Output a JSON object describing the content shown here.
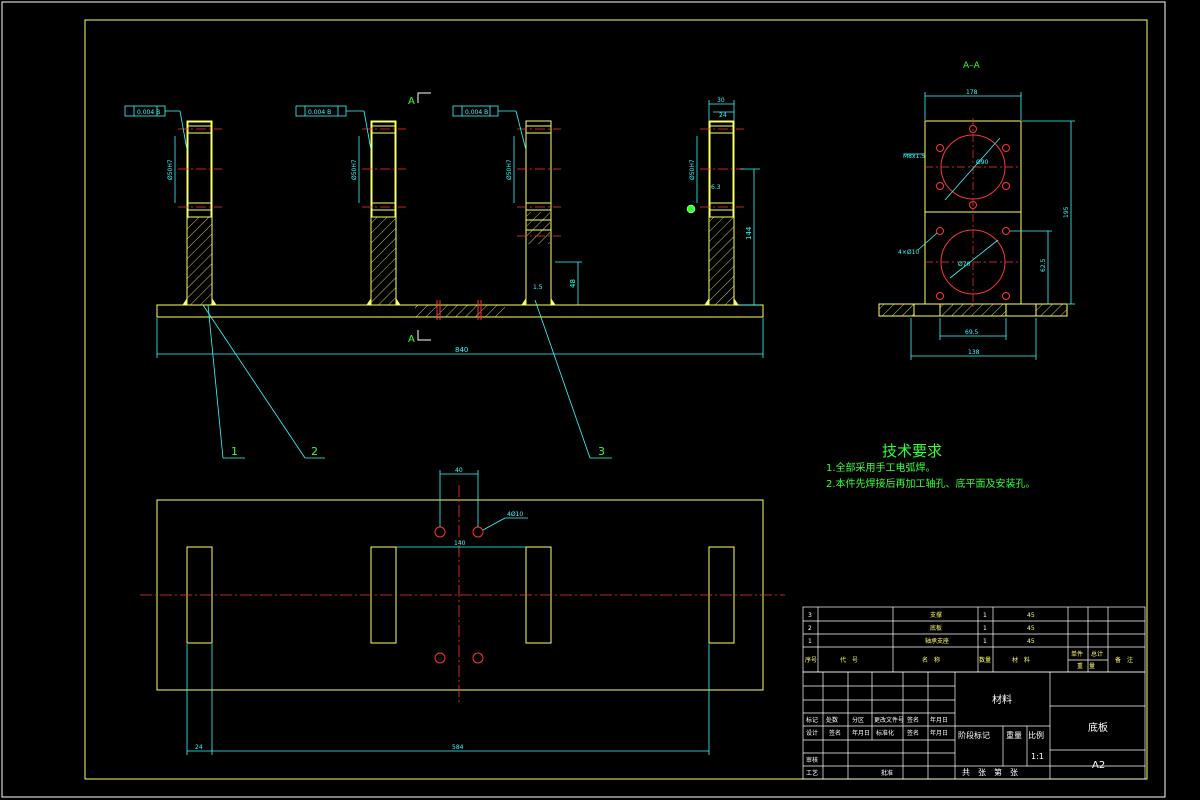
{
  "view_labels": {
    "section_A_top": "A",
    "section_A_bottom": "A",
    "section_view_title": "A–A"
  },
  "tolerances": [
    "0.004 B",
    "0.004 B",
    "0.004 B"
  ],
  "dimensions": {
    "overall_length": "840",
    "tube_height": "144",
    "weld_height": "48",
    "side_width": "178",
    "side_height": "195",
    "side_base_width": "138",
    "side_base_inner": "69.5",
    "side_hole_height": "62.5",
    "circle_top": "Ø90",
    "circle_bottom": "Ø70",
    "hole_spec_top": "M8x1.5",
    "hole_spec_left": "4×Ø10",
    "plan_hole_spacing": "40",
    "plan_center_span": "140",
    "plan_edge": "24",
    "plan_span": "584",
    "plan_hole_spec": "4Ø10",
    "bolt_dim": "30",
    "bolt_sub": "24",
    "chamfer": "1.5",
    "fit_1": "Ø50H7",
    "fit_2": "Ø50H7",
    "fit_3": "Ø50H7",
    "fit_4": "Ø50H7",
    "spot": "6.3"
  },
  "balloons": [
    "1",
    "2",
    "3"
  ],
  "tech_requirements": {
    "title": "技术要求",
    "items": [
      "1.全部采用手工电弧焊。",
      "2.本件先焊接后再加工轴孔、底平面及安装孔。"
    ]
  },
  "parts_list": {
    "rows": [
      {
        "no": "3",
        "name": "支撑",
        "qty": "1",
        "material": "45"
      },
      {
        "no": "2",
        "name": "底板",
        "qty": "1",
        "material": "45"
      },
      {
        "no": "1",
        "name": "轴承支座",
        "qty": "1",
        "material": "45"
      }
    ],
    "header": {
      "no": "序号",
      "code": "代　号",
      "name": "名　称",
      "qty": "数量",
      "material": "材　料",
      "unit_weight": "单件",
      "total_weight": "总计",
      "weight": "重　量",
      "remark": "备　注"
    }
  },
  "title_block": {
    "material_label": "材料",
    "part_name": "底板",
    "sheet_size": "A2",
    "scale": "1:1",
    "stage_mark": "阶段标记",
    "weight": "重量",
    "scale_label": "比例",
    "sheets": "共　张　第　张",
    "rev_row": [
      "标记",
      "处数",
      "分区",
      "更改文件号",
      "签名",
      "年月日"
    ],
    "design_row": [
      "设计",
      "签名",
      "年月日",
      "标准化",
      "签名",
      "年月日"
    ],
    "check": "审核",
    "process": "工艺",
    "approve": "批准"
  },
  "colors": {
    "background": "#000000",
    "outline": "#ffff66",
    "dimension": "#33ffff",
    "centerline": "#ff3333",
    "text": "#ffffff",
    "green": "#33ff33",
    "hatch": "#ffff66"
  }
}
